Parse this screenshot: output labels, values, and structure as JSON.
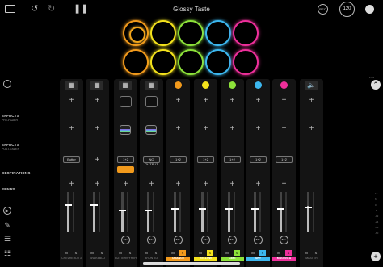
{
  "app": {
    "title": "Glossy Taste",
    "bpm": "120",
    "rec_label": "REC"
  },
  "sidebar": {
    "effects_pre": "EFFECTS",
    "effects_pre_sub": "PRE-FADER",
    "effects_post": "EFFECTS",
    "effects_post_sub": "POST-FADER",
    "destinations": "DESTINATIONS",
    "sends": "SENDS"
  },
  "pads": [
    {
      "color": "#f29a1c",
      "active": true
    },
    {
      "color": "#f4e21c",
      "active": false
    },
    {
      "color": "#8de23a",
      "active": false
    },
    {
      "color": "#3cb7ef",
      "active": false
    },
    {
      "color": "#ef2f9b",
      "active": false
    },
    {
      "color": "#f29a1c",
      "active": false
    },
    {
      "color": "#f4e21c",
      "active": false
    },
    {
      "color": "#8de23a",
      "active": false
    },
    {
      "color": "#3cb7ef",
      "active": false
    },
    {
      "color": "#ef2f9b",
      "active": false
    }
  ],
  "tracks": [
    {
      "name": "CHEVRERLO 3",
      "destination": "Butter",
      "pan": "",
      "fader_level": 0.7
    },
    {
      "name": "SNAKEBLO",
      "destination": "",
      "pan": "",
      "fader_level": 0.7
    },
    {
      "name": "BUTTERWYRTH",
      "destination": "1+2",
      "pan": "BAL",
      "fader_level": 0.55
    },
    {
      "name": "BRONTEA",
      "destination": "NO OUTPUT",
      "pan": "BAL",
      "fader_level": 0.55
    },
    {
      "name": "ORANGE",
      "color": "#f29a1c",
      "destination": "1+2",
      "pan": "BAL",
      "fader_level": 0.6,
      "solo": true
    },
    {
      "name": "YELLOW",
      "color": "#f4e21c",
      "destination": "1+2",
      "pan": "BAL",
      "fader_level": 0.6,
      "solo": true
    },
    {
      "name": "LIME",
      "color": "#8de23a",
      "destination": "1+2",
      "pan": "BAL",
      "fader_level": 0.6,
      "solo": true
    },
    {
      "name": "SKY",
      "color": "#3cb7ef",
      "destination": "1+2",
      "pan": "BAL",
      "fader_level": 0.6,
      "solo": true
    },
    {
      "name": "MAGENTA",
      "color": "#ef2f9b",
      "destination": "1+2",
      "pan": "BAL",
      "fader_level": 0.6,
      "solo": true
    },
    {
      "name": "MASTER",
      "destination": "",
      "pan": "",
      "fader_level": 0.65
    }
  ],
  "labels": {
    "mute": "M",
    "solo": "S"
  },
  "percent": "27%",
  "scale": [
    "12",
    "6",
    "0",
    "-6",
    "-12",
    "-24",
    "-36",
    "-60"
  ]
}
